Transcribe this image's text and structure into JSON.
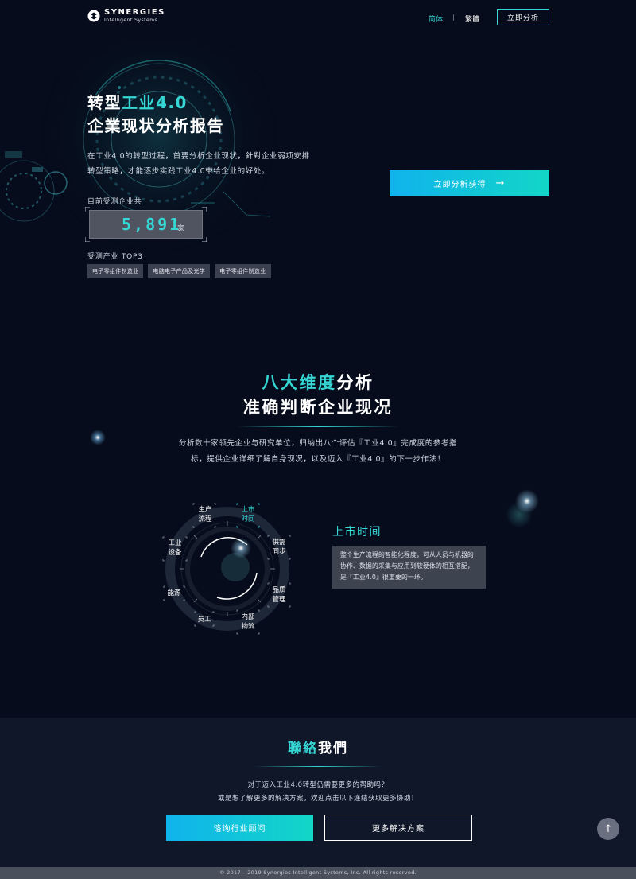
{
  "brand": {
    "name": "SYNERGIES",
    "sub": "Intelligent Systems"
  },
  "header": {
    "lang_simplified": "简体",
    "lang_separator": "|",
    "lang_traditional": "繁體",
    "cta": "立即分析"
  },
  "hero": {
    "title_line1_a": "转型",
    "title_line1_b": "工业4.0",
    "title_line2": "企業现状分析报告",
    "desc": "在工业4.0的转型过程，首要分析企业现状，針對企业弱项安排转型策略，才能逐步实践工业4.0带给企业的好处。",
    "count_label": "目前受测企业共",
    "count_value": "5,891",
    "count_unit": "家",
    "top3_label": "受测产业 TOP3",
    "tags": [
      "电子零组件制造业",
      "电脑电子产品及光学",
      "电子零组件制造业"
    ],
    "cta": "立即分析获得",
    "cta_arrow": "→"
  },
  "dimensions": {
    "title_a": "八大维度",
    "title_b": "分析",
    "title_line2": "准确判断企业现况",
    "desc": "分析数十家领先企业与研究单位，归纳出八个评估『工业4.0』完成度的参考指标，提供企业详细了解自身现况，以及迈入『工业4.0』的下一步作法！",
    "items": [
      {
        "label": "生产\n流程"
      },
      {
        "label": "上市\n时间"
      },
      {
        "label": "供需\n同步"
      },
      {
        "label": "品质\n管理"
      },
      {
        "label": "内部\n物流"
      },
      {
        "label": "员工"
      },
      {
        "label": "能源"
      },
      {
        "label": "工业\n设备"
      }
    ],
    "active_index": 1,
    "detail_title": "上市时间",
    "detail_text": "整个生产流程的智能化程度，可从人员与机器的协作、数据的采集与应用到软硬体的相互搭配，是『工业4.0』很重要的一环。"
  },
  "contact": {
    "title_a": "聯絡",
    "title_b": "我們",
    "desc_line1": "对于迈入工业4.0转型仍需要更多的帮助吗？",
    "desc_line2": "或是想了解更多的解决方案，欢迎点击以下连结获取更多协助！",
    "btn_consult": "谘询行业顾问",
    "btn_more": "更多解决方案",
    "scroll_top": "↑"
  },
  "footer": {
    "copyright": "© 2017 – 2019 Synergies Intelligent Systems, Inc. All rights reserved."
  },
  "colors": {
    "accent": "#35d6d4",
    "background": "#060c1b",
    "gradient_start": "#10b3ec",
    "gradient_end": "#12d6c7"
  }
}
